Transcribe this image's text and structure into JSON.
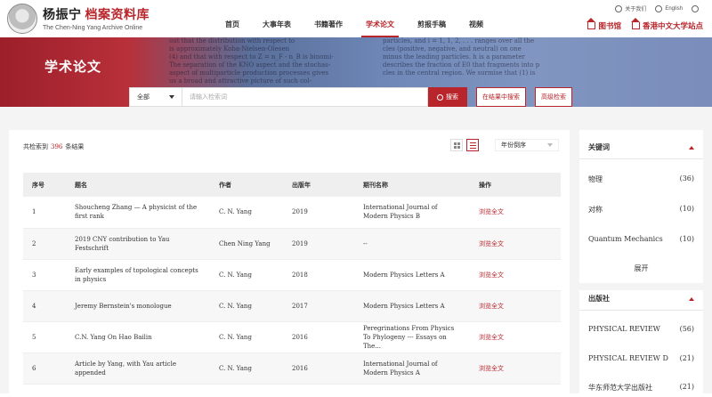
{
  "brand": {
    "cn_name": "杨振宁",
    "cn_sub": "档案资料库",
    "en": "The Chen-Ning Yang Archive Online"
  },
  "nav": [
    "首页",
    "大事年表",
    "书籍著作",
    "学术论文",
    "剪报手稿",
    "视频"
  ],
  "nav_active": 3,
  "util": {
    "about": "关于我们",
    "lang": "English"
  },
  "links": {
    "library": "图书馆",
    "cuhk": "香港中文大学站点"
  },
  "banner": {
    "title": "学术论文",
    "paper_left": [
      "out that the distribution with respect to",
      "is approximately Koba-Nielsen-Olesen",
      "(4) and that with respect to Z = n_F - n_B is binomi-",
      "The separation of the KNO aspect and the stochas-",
      "aspect of multiparticle production processes gives",
      "us a broad and attractive picture of such col-"
    ],
    "paper_right": [
      "particles, and i = 1, 1, 2, . . . ranges over all the",
      "cles (positive, negative, and neutral) on one",
      "minus the leading particles. h is a parameter",
      "describes the fraction of E0 that fragments into p",
      "cles in the central region. We surmise that (1) is"
    ]
  },
  "search": {
    "scope": "全部",
    "placeholder": "请输入检索词",
    "button": "搜索",
    "within": "在结果中搜索",
    "advanced": "高级检索"
  },
  "results": {
    "prefix": "共检索到",
    "count": "396",
    "suffix": "条结果",
    "sort": "年份倒序"
  },
  "table": {
    "headers": [
      "序号",
      "题名",
      "作者",
      "出版年",
      "期刊名称",
      "操作"
    ],
    "rows": [
      {
        "no": "1",
        "title": "Shoucheng Zhang — A physicist of the first rank",
        "author": "C. N. Yang",
        "year": "2019",
        "journal": "International Journal of Modern Physics B",
        "action": "浏览全文"
      },
      {
        "no": "2",
        "title": "2019 CNY contribution to Yau Festschrift",
        "author": "Chen Ning Yang",
        "year": "2019",
        "journal": "--",
        "action": "浏览全文"
      },
      {
        "no": "3",
        "title": "Early examples of topological concepts in physics",
        "author": "C. N. Yang",
        "year": "2018",
        "journal": "Modern Physics Letters A",
        "action": "浏览全文"
      },
      {
        "no": "4",
        "title": "Jeremy Bernstein's monologue",
        "author": "C. N. Yang",
        "year": "2017",
        "journal": "Modern Physics Letters A",
        "action": "浏览全文"
      },
      {
        "no": "5",
        "title": "C.N. Yang On Hao Bailin",
        "author": "C. N. Yang",
        "year": "2016",
        "journal": "Peregrinations From Physics To Phylogeny --- Essays on The...",
        "action": "浏览全文"
      },
      {
        "no": "6",
        "title": "Article by Yang, with Yau article appended",
        "author": "C. N. Yang",
        "year": "2016",
        "journal": "International Journal of Modern Physics A",
        "action": "浏览全文"
      }
    ]
  },
  "sidebar": {
    "keywords_title": "关键词",
    "keywords": [
      {
        "label": "物理",
        "count": "(36)"
      },
      {
        "label": "对称",
        "count": "(10)"
      },
      {
        "label": "Quantum Mechanics",
        "count": "(10)"
      }
    ],
    "more": "展开",
    "publisher_title": "出版社",
    "publishers": [
      {
        "label": "PHYSICAL REVIEW",
        "count": "(56)"
      },
      {
        "label": "PHYSICAL REVIEW D",
        "count": "(21)"
      },
      {
        "label": "华东师范大学出版社",
        "count": "(21)"
      }
    ]
  }
}
